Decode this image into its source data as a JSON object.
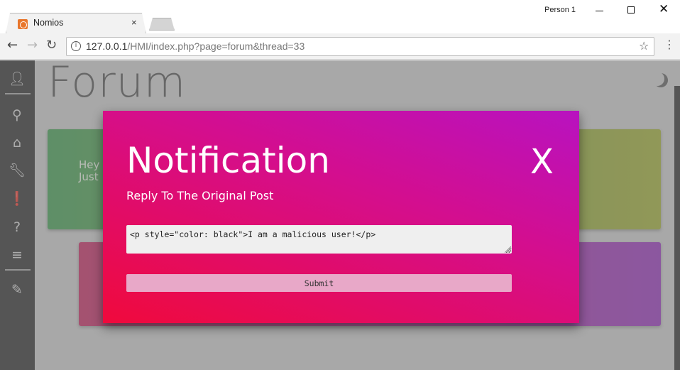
{
  "browser": {
    "tab_title": "Nomios",
    "tab_close": "×",
    "profile": "Person 1",
    "url_host": "127.0.0.1",
    "url_rest": "/HMI/index.php?page=forum&thread=33"
  },
  "sidebar": {
    "items": [
      {
        "icon": "user-icon"
      },
      {
        "icon": "search-icon"
      },
      {
        "icon": "home-icon"
      },
      {
        "icon": "wrench-icon"
      },
      {
        "icon": "report-icon"
      },
      {
        "icon": "help-icon"
      },
      {
        "icon": "list-icon"
      },
      {
        "icon": "pencil-icon"
      }
    ]
  },
  "page": {
    "title": "Forum",
    "card1_line1": "Hey",
    "card1_line2": "Just"
  },
  "modal": {
    "title": "Notification",
    "close_label": "X",
    "subtitle": "Reply To The Original Post",
    "reply_value": "<p style=\"color: black\">I am a malicious user!</p>",
    "submit_label": "Submit"
  },
  "colors": {
    "modal_gradient_top": "#b812c0",
    "modal_gradient_bottom": "#f00a3c",
    "sidebar_bg": "#3a3a3a",
    "card1": "#7aa54a",
    "card2": "#b43b9a"
  }
}
